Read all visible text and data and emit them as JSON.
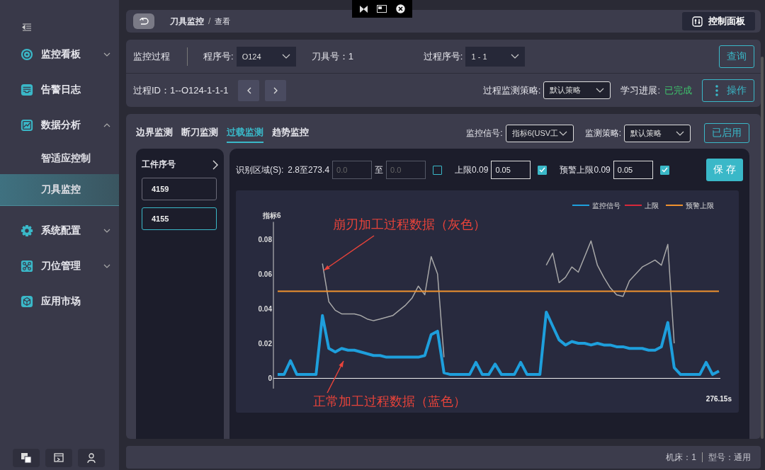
{
  "sidebar": {
    "items": [
      {
        "label": "监控看板",
        "expanded": false
      },
      {
        "label": "告警日志"
      },
      {
        "label": "数据分析",
        "expanded": true,
        "children": [
          {
            "label": "智适应控制",
            "selected": false
          },
          {
            "label": "刀具监控",
            "selected": true
          }
        ]
      },
      {
        "label": "系统配置",
        "expanded": false
      },
      {
        "label": "刀位管理",
        "expanded": false
      },
      {
        "label": "应用市场"
      }
    ]
  },
  "header": {
    "breadcrumb": [
      "刀具监控",
      "查看"
    ],
    "breadcrumb_separator": "/",
    "control_button": "控制面板"
  },
  "process_card": {
    "title": "监控过程",
    "program_label": "程序号:",
    "program_value": "O124",
    "tool_label": "刀具号：1",
    "step_label": "过程序号:",
    "step_value": "1 - 1",
    "query_button": "查询",
    "process_id": "过程ID：1--O124-1-1-1",
    "strategy_label": "过程监测策略:",
    "strategy_value": "默认策略",
    "progress_label": "学习进展:",
    "progress_value": "已完成",
    "action_button": "操作"
  },
  "monitor_card": {
    "tabs": [
      {
        "label": "边界监测",
        "selected": false
      },
      {
        "label": "断刀监测",
        "selected": false
      },
      {
        "label": "过载监测",
        "selected": true
      },
      {
        "label": "趋势监控",
        "selected": false
      }
    ],
    "signal_label": "监控信号:",
    "signal_value": "指标6(USV工",
    "strategy_label": "监测策略:",
    "strategy_value": "默认策略",
    "enabled_button": "已启用",
    "workpieces": {
      "title": "工件序号",
      "items": [
        {
          "label": "4159",
          "selected": false
        },
        {
          "label": "4155",
          "selected": true
        }
      ]
    },
    "toolbar": {
      "region_label": "识别区域(S):",
      "region_range": "2.8至273.4",
      "from_placeholder": "0.0",
      "to_label": "至",
      "to_placeholder": "0.0",
      "region_checked": false,
      "upper_label": "上限0.09",
      "upper_value": "0.05",
      "upper_checked": true,
      "warn_label": "预警上限0.09",
      "warn_value": "0.05",
      "warn_checked": true,
      "save_button": "保 存"
    },
    "chart_data": {
      "type": "line",
      "ylabel": "指标6",
      "ylim": [
        0,
        0.09
      ],
      "legend": true,
      "yticks": [
        {
          "value": 0,
          "label": "0"
        },
        {
          "value": 0.02,
          "label": "0.02"
        },
        {
          "value": 0.04,
          "label": "0.04"
        },
        {
          "value": 0.06,
          "label": "0.06"
        },
        {
          "value": 0.08,
          "label": "0.08"
        }
      ],
      "series": [
        {
          "color": "#a8a8a8",
          "values": [
            null,
            null,
            null,
            null,
            null,
            null,
            null,
            0.066,
            0.044,
            0.039,
            0.037,
            0.037,
            0.037,
            0.036,
            0.034,
            0.033,
            0.034,
            0.035,
            0.036,
            0.039,
            0.042,
            0.046,
            0.053,
            0.048,
            0.07,
            0.06,
            0.012,
            null,
            null,
            null,
            null,
            null,
            null,
            null,
            null,
            null,
            null,
            null,
            null,
            null,
            null,
            null,
            0.065,
            0.072,
            0.055,
            0.058,
            0.064,
            0.061,
            0.07,
            0.079,
            0.065,
            0.058,
            0.052,
            0.048,
            0.047,
            0.056,
            0.06,
            0.064,
            0.066,
            0.068,
            0.065,
            0.077,
            0.02,
            null,
            null,
            null,
            null,
            null,
            null,
            null
          ]
        },
        {
          "name": "监控信号",
          "color": "#1e9fdc",
          "values": [
            0.002,
            0.002,
            0.01,
            0.002,
            0.002,
            0.002,
            0.002,
            0.036,
            0.017,
            0.015,
            0.017,
            0.016,
            0.016,
            0.015,
            0.014,
            0.013,
            0.013,
            0.012,
            0.012,
            0.012,
            0.012,
            0.012,
            0.012,
            0.013,
            0.025,
            0.027,
            0.003,
            0.002,
            0.002,
            0.002,
            0.002,
            0.009,
            0.002,
            0.002,
            0.008,
            0.002,
            0.002,
            0.002,
            0.009,
            0.002,
            0.002,
            0.002,
            0.038,
            0.03,
            0.022,
            0.019,
            0.021,
            0.02,
            0.02,
            0.019,
            0.02,
            0.019,
            0.019,
            0.018,
            0.018,
            0.017,
            0.017,
            0.017,
            0.016,
            0.016,
            0.018,
            0.032,
            0.006,
            0.002,
            0.002,
            0.002,
            0.002,
            0.009,
            0.002,
            0.004
          ]
        },
        {
          "name": "上限",
          "color": "#d8283a",
          "values": [
            null,
            null,
            null,
            null,
            null,
            null,
            null,
            null,
            null,
            null,
            null,
            null,
            null,
            null,
            null,
            null,
            null,
            null,
            null,
            null,
            null,
            null,
            null,
            null,
            null,
            null,
            null,
            null,
            null,
            null,
            null,
            null,
            null,
            null,
            null,
            null,
            null,
            null,
            null,
            null,
            null,
            null,
            null,
            null,
            null,
            null,
            null,
            null,
            null,
            null,
            null,
            null,
            null,
            null,
            null,
            null,
            null,
            null,
            null,
            null,
            null,
            null,
            null,
            null,
            null,
            null,
            null,
            null,
            null,
            null
          ]
        },
        {
          "name": "预警上限",
          "color": "#f0922e",
          "values": [
            0.05,
            0.05,
            0.05,
            0.05,
            0.05,
            0.05,
            0.05,
            0.05,
            0.05,
            0.05,
            0.05,
            0.05,
            0.05,
            0.05,
            0.05,
            0.05,
            0.05,
            0.05,
            0.05,
            0.05,
            0.05,
            0.05,
            0.05,
            0.05,
            0.05,
            0.05,
            0.05,
            0.05,
            0.05,
            0.05,
            0.05,
            0.05,
            0.05,
            0.05,
            0.05,
            0.05,
            0.05,
            0.05,
            0.05,
            0.05,
            0.05,
            0.05,
            0.05,
            0.05,
            0.05,
            0.05,
            0.05,
            0.05,
            0.05,
            0.05,
            0.05,
            0.05,
            0.05,
            0.05,
            0.05,
            0.05,
            0.05,
            0.05,
            0.05,
            0.05,
            0.05,
            0.05,
            0.05,
            0.05,
            0.05,
            0.05,
            0.05,
            0.05,
            0.05,
            0.05
          ]
        }
      ],
      "annotations": [
        {
          "text": "崩刃加工过程数据（灰色）"
        },
        {
          "text": "正常加工过程数据（蓝色）"
        },
        {
          "text": "276.15s"
        }
      ]
    }
  },
  "footer": {
    "machine": "机床：1",
    "model": "型号：通用"
  }
}
